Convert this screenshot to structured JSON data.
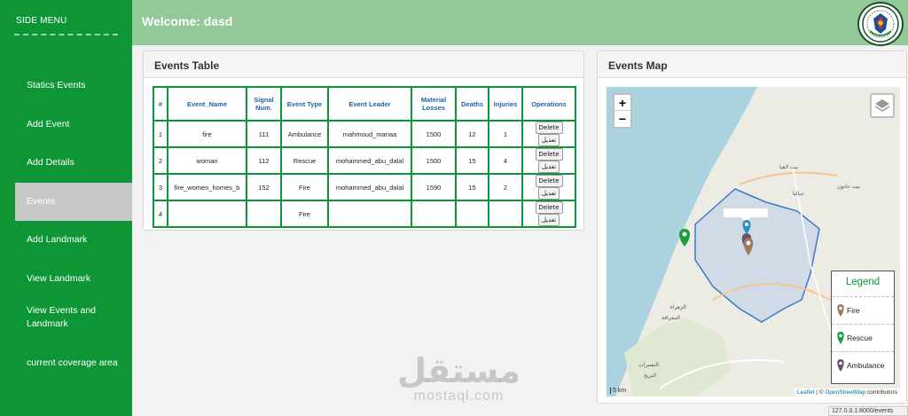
{
  "sidebar": {
    "title": "SIDE MENU",
    "items": [
      {
        "label": "Statics Events"
      },
      {
        "label": "Add Event"
      },
      {
        "label": "Add Details"
      },
      {
        "label": "Events"
      },
      {
        "label": "Add Landmark"
      },
      {
        "label": "View Landmark"
      },
      {
        "label": "View Events and Landmark"
      },
      {
        "label": "current coverage area"
      }
    ],
    "active_index": 3
  },
  "header": {
    "welcome": "Welcome: dasd"
  },
  "events_panel": {
    "title": "Events Table",
    "columns": [
      "#",
      "Event_Name",
      "Signal Num.",
      "Event Type",
      "Event Leader",
      "Material Losses",
      "Deaths",
      "Injuries",
      "Operations"
    ],
    "rows": [
      {
        "id": "1",
        "name": "fire",
        "signal": "111",
        "type": "Ambulance",
        "leader": "mahmoud_manaa",
        "losses": "1500",
        "deaths": "12",
        "injuries": "1"
      },
      {
        "id": "2",
        "name": "woman",
        "signal": "112",
        "type": "Rescue",
        "leader": "mohammed_abu_dalal",
        "losses": "1500",
        "deaths": "15",
        "injuries": "4"
      },
      {
        "id": "3",
        "name": "fire_women_homes_b",
        "signal": "152",
        "type": "Fire",
        "leader": "mohammed_abu_dalal",
        "losses": "1590",
        "deaths": "15",
        "injuries": "2"
      },
      {
        "id": "4",
        "name": "",
        "signal": "",
        "type": "Fire",
        "leader": "",
        "losses": "",
        "deaths": "",
        "injuries": ""
      }
    ],
    "delete_label": "Delete",
    "edit_label": "تعديل"
  },
  "map_panel": {
    "title": "Events Map",
    "zoom_in": "+",
    "zoom_out": "−",
    "legend": {
      "title": "Legend",
      "items": [
        {
          "label": "Fire",
          "color": "#a0785a"
        },
        {
          "label": "Rescue",
          "color": "#1e9e3e"
        },
        {
          "label": "Ambulance",
          "color": "#6a4f6f"
        }
      ]
    },
    "scale": "5 km",
    "attribution_leaflet": "Leaflet",
    "attribution_sep": " | © ",
    "attribution_osm": "OpenStreetMap",
    "attribution_rest": " contributors",
    "place_labels": [
      "بيت لاهيا",
      "جباليا",
      "بيت حانون",
      "الزهراء",
      "المغراقة",
      "النصيرات",
      "البريج"
    ]
  },
  "status_url": "127.0.0.1:8000/events",
  "watermark": {
    "big": "مستقل",
    "small": "mostaql.com"
  },
  "colors": {
    "sidebar": "#0e9636",
    "header": "#93c998",
    "table_border": "#0e9636",
    "header_text": "#1c63ad"
  }
}
